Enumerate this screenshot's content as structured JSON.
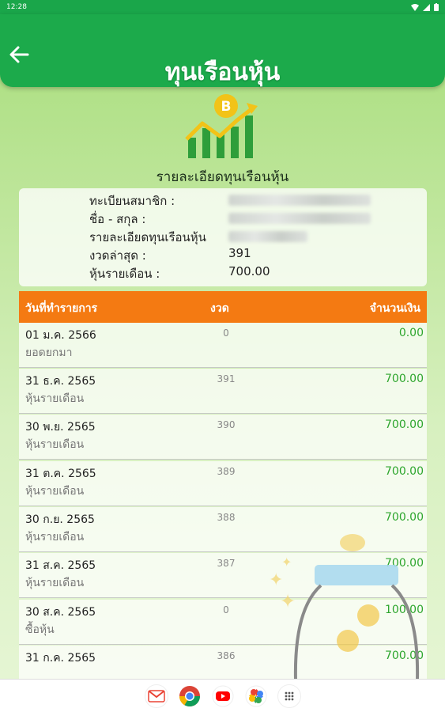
{
  "status": {
    "time": "12:28"
  },
  "header": {
    "title": "ทุนเรือนหุ้น"
  },
  "section": {
    "title": "รายละเอียดทุนเรือนหุ้น"
  },
  "info": {
    "member_no_label": "ทะเบียนสมาชิก :",
    "name_label": "ชื่อ - สกุล :",
    "detail_label": "รายละเอียดทุนเรือนหุ้น",
    "latest_period_label": "งวดล่าสุด :",
    "latest_period_value": "391",
    "monthly_share_label": "หุ้นรายเดือน :",
    "monthly_share_value": "700.00"
  },
  "table": {
    "headers": [
      "วันที่ทำรายการ",
      "งวด",
      "จำนวนเงิน"
    ],
    "rows": [
      {
        "date": "01 ม.ค. 2566",
        "desc": "ยอดยกมา",
        "period": "0",
        "amount": "0.00"
      },
      {
        "date": "31 ธ.ค. 2565",
        "desc": "หุ้นรายเดือน",
        "period": "391",
        "amount": "700.00"
      },
      {
        "date": "30 พ.ย. 2565",
        "desc": "หุ้นรายเดือน",
        "period": "390",
        "amount": "700.00"
      },
      {
        "date": "31 ต.ค. 2565",
        "desc": "หุ้นรายเดือน",
        "period": "389",
        "amount": "700.00"
      },
      {
        "date": "30 ก.ย. 2565",
        "desc": "หุ้นรายเดือน",
        "period": "388",
        "amount": "700.00"
      },
      {
        "date": "31 ส.ค. 2565",
        "desc": "หุ้นรายเดือน",
        "period": "387",
        "amount": "700.00"
      },
      {
        "date": "30 ส.ค. 2565",
        "desc": "ซื้อหุ้น",
        "period": "0",
        "amount": "100.00"
      },
      {
        "date": "31 ก.ค. 2565",
        "desc": "",
        "period": "386",
        "amount": "700.00"
      }
    ]
  },
  "colors": {
    "primary": "#1caa4b",
    "header_orange": "#f47a12",
    "amount_green": "#2ea62e"
  },
  "icons": [
    "arrow-back-icon",
    "bitcoin-chart-logo",
    "gmail-icon",
    "chrome-icon",
    "youtube-icon",
    "photos-icon",
    "app-drawer-icon"
  ]
}
